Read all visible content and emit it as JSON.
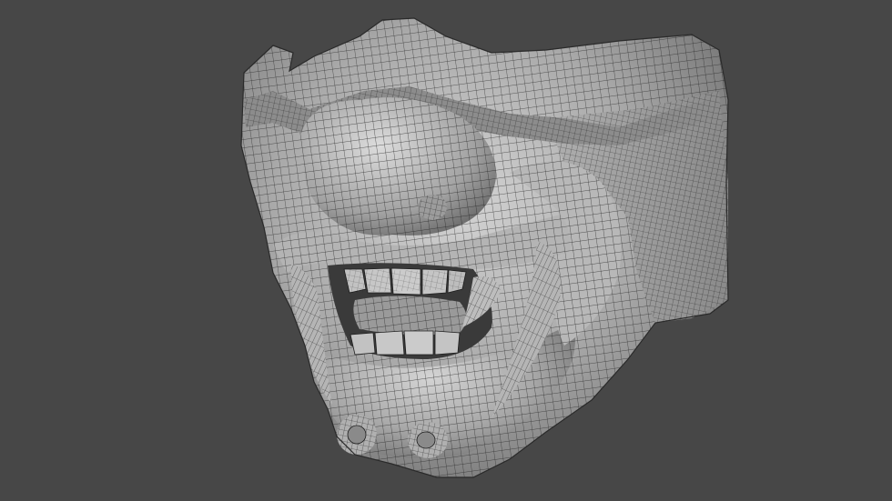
{
  "viewport": {
    "background_color": "#474747",
    "mesh_fill_color": "#a9a9a9",
    "mesh_shade_color": "#7c7c7c",
    "mesh_highlight_color": "#d4d4d4",
    "wire_color": "#1e1e1e"
  },
  "model": {
    "subject": "oni-mask-wireframe"
  }
}
